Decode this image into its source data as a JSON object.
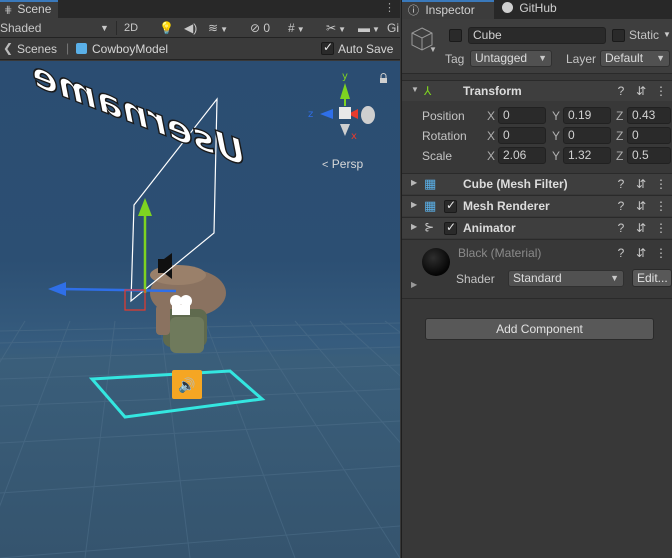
{
  "scene": {
    "tab_label": "Scene",
    "shading_mode": "Shaded",
    "mode_2d": "2D",
    "hidden_count": "0",
    "gizmos_label": "Gi",
    "breadcrumb_root": "Scenes",
    "breadcrumb_prefab": "CowboyModel",
    "auto_save_label": "Auto Save",
    "auto_save_checked": true,
    "persp_label": "Persp",
    "gizmo_axis_x": "x",
    "gizmo_axis_y": "y",
    "gizmo_axis_z": "z",
    "username_text": "Username"
  },
  "inspector": {
    "tab_inspector": "Inspector",
    "tab_github": "GitHub",
    "object_name": "Cube",
    "static_label": "Static",
    "tag_label": "Tag",
    "tag_value": "Untagged",
    "layer_label": "Layer",
    "layer_value": "Default",
    "transform": {
      "title": "Transform",
      "position_label": "Position",
      "rotation_label": "Rotation",
      "scale_label": "Scale",
      "axis_x": "X",
      "axis_y": "Y",
      "axis_z": "Z",
      "position": [
        "0",
        "0.19",
        "0.43"
      ],
      "rotation": [
        "0",
        "0",
        "0"
      ],
      "scale": [
        "2.06",
        "1.32",
        "0.5"
      ]
    },
    "components": [
      {
        "title": "Cube (Mesh Filter)"
      },
      {
        "title": "Mesh Renderer"
      },
      {
        "title": "Animator"
      }
    ],
    "material": {
      "name": "Black (Material)",
      "shader_label": "Shader",
      "shader_value": "Standard",
      "edit_label": "Edit..."
    },
    "add_component_label": "Add Component"
  },
  "colors": {
    "accent": "#3a79bb",
    "axis_x": "#e83a2c",
    "axis_y": "#7ed321",
    "axis_z": "#2f6fe8",
    "selection_outline": "#ffffff",
    "highlight_cyan": "#34e6e0",
    "audio_icon": "#f5a623"
  }
}
